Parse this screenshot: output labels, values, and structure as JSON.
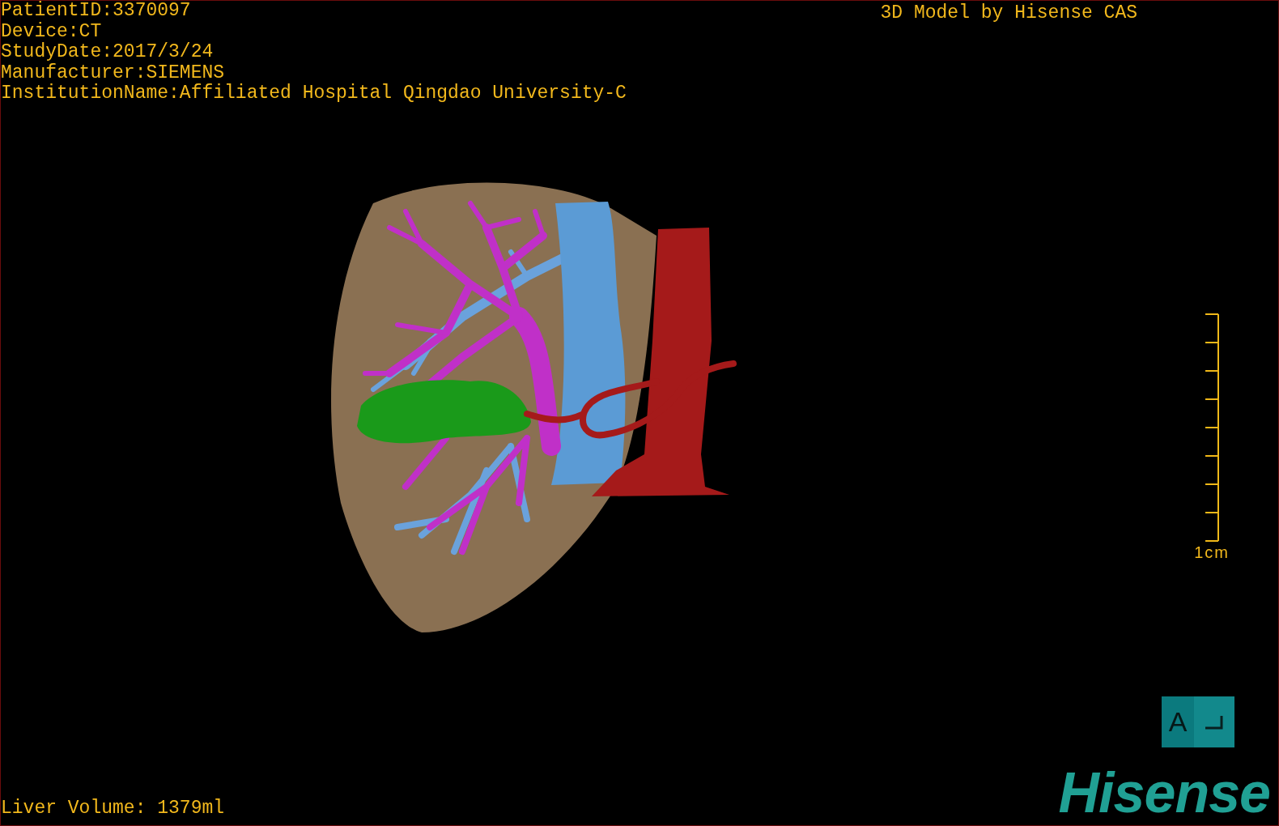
{
  "header": {
    "lines": [
      "PatientID:3370097",
      "Device:CT",
      "StudyDate:2017/3/24",
      "Manufacturer:SIEMENS",
      "InstitutionName:Affiliated Hospital Qingdao University-C"
    ]
  },
  "credit": "3D Model by Hisense CAS",
  "scale_bar": {
    "label": "1cm"
  },
  "orientation_cube": {
    "label": "A"
  },
  "logo": "Hisense",
  "footer": {
    "liver_volume": "Liver Volume: 1379ml"
  }
}
